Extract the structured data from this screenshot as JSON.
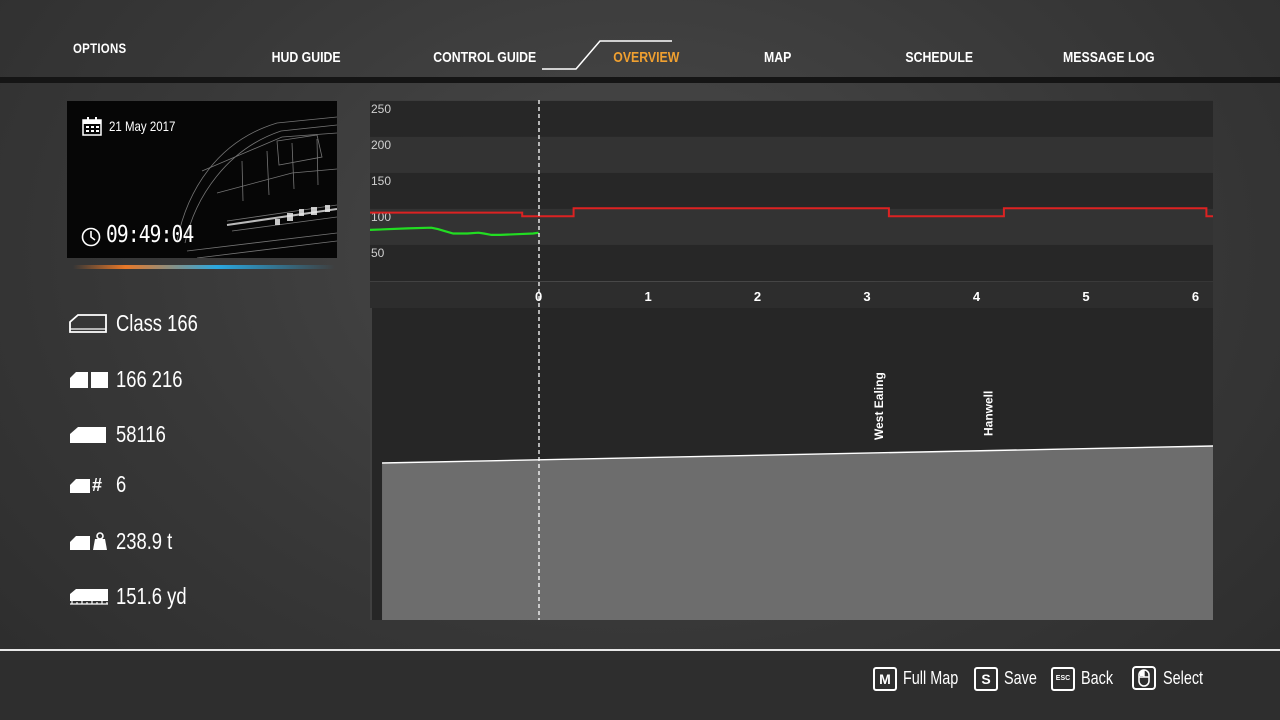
{
  "nav": {
    "options_label": "OPTIONS",
    "tabs": [
      {
        "label": "HUD GUIDE"
      },
      {
        "label": "CONTROL GUIDE"
      },
      {
        "label": "OVERVIEW",
        "active": true
      },
      {
        "label": "MAP"
      },
      {
        "label": "SCHEDULE"
      },
      {
        "label": "MESSAGE LOG"
      }
    ]
  },
  "card": {
    "date": "21 May 2017",
    "time": "09:49:04",
    "date_icon": "calendar-icon",
    "time_icon": "clock-icon"
  },
  "stats": [
    {
      "icon": "locomotive-class-icon",
      "value": "Class 166"
    },
    {
      "icon": "train-number-icon",
      "value": "166 216"
    },
    {
      "icon": "unit-number-icon",
      "value": "58116"
    },
    {
      "icon": "car-count-icon",
      "value": "6"
    },
    {
      "icon": "train-weight-icon",
      "value": "238.9 t"
    },
    {
      "icon": "train-length-icon",
      "value": "151.6 yd"
    }
  ],
  "chart_data": {
    "type": "line",
    "title": "",
    "y_ticks": [
      "250",
      "200",
      "150",
      "100",
      "50"
    ],
    "x_ticks": [
      "0",
      "1",
      "2",
      "3",
      "4",
      "5",
      "6"
    ],
    "ylim": [
      0,
      250
    ],
    "xlim": [
      -1.54,
      6.16
    ],
    "series": [
      {
        "color": "#dd2222",
        "points": [
          [
            -1.54,
            95
          ],
          [
            -0.15,
            95
          ],
          [
            -0.15,
            90
          ],
          [
            0.32,
            90
          ],
          [
            0.32,
            101
          ],
          [
            3.2,
            101
          ],
          [
            3.2,
            90
          ],
          [
            4.25,
            90
          ],
          [
            4.25,
            101
          ],
          [
            6.1,
            101
          ],
          [
            6.1,
            90
          ],
          [
            6.16,
            90
          ]
        ]
      },
      {
        "color": "#22dd22",
        "points": [
          [
            -1.54,
            71
          ],
          [
            -1.2,
            73
          ],
          [
            -0.98,
            74
          ],
          [
            -0.92,
            72
          ],
          [
            -0.85,
            69
          ],
          [
            -0.78,
            66
          ],
          [
            -0.65,
            66
          ],
          [
            -0.55,
            67
          ],
          [
            -0.5,
            66
          ],
          [
            -0.43,
            64
          ],
          [
            -0.35,
            64
          ],
          [
            -0.2,
            65
          ],
          [
            -0.05,
            66
          ],
          [
            0.0,
            67
          ]
        ]
      }
    ],
    "elevation": {
      "stations": [
        {
          "name": "West Ealing",
          "x": 3.1
        },
        {
          "name": "Hanwell",
          "x": 4.1
        }
      ],
      "profile": [
        [
          -1.43,
          0
        ],
        [
          6.16,
          100
        ]
      ]
    }
  },
  "actions": [
    {
      "key": "M",
      "label": "Full Map"
    },
    {
      "key": "S",
      "label": "Save"
    },
    {
      "key": "ESC",
      "label": "Back"
    },
    {
      "key": "mouse",
      "label": "Select"
    }
  ],
  "colors": {
    "active_tab": "#f0a030",
    "speed_limit": "#dd2222",
    "speed_actual": "#22dd22"
  }
}
